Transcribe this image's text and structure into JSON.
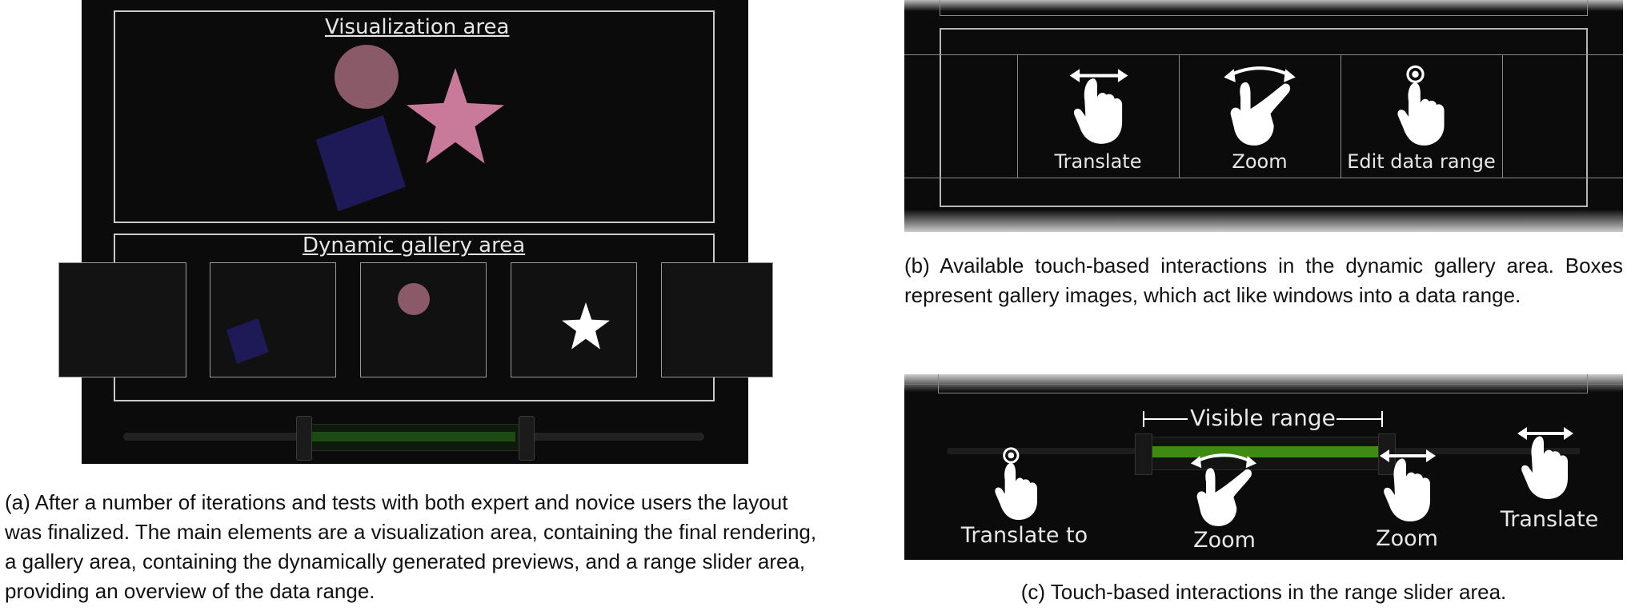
{
  "panel_a": {
    "visualization_label": "Visualization area",
    "gallery_label": "Dynamic gallery area",
    "caption": "(a) After a number of iterations and tests with both expert and novice users the layout was finalized. The main elements are a visualization area, containing the final rendering, a gallery area, containing the dynamically generated previews, and a range slider area, providing an overview of the data range.",
    "colors": {
      "circle": "#8b5a68",
      "star": "#c9799a",
      "square": "#1e1a58",
      "slider_fill": "#1c4a12"
    }
  },
  "panel_b": {
    "gestures": [
      {
        "label": "Translate",
        "icon": "translate-gesture-icon"
      },
      {
        "label": "Zoom",
        "icon": "zoom-gesture-icon"
      },
      {
        "label": "Edit data range",
        "icon": "tap-gesture-icon"
      }
    ],
    "caption": "(b) Available touch-based interactions in the dynamic gallery area. Boxes represent gallery images, which act like windows into a data range."
  },
  "panel_c": {
    "visible_range_label": "Visible range",
    "labels": {
      "translate_to": "Translate to",
      "zoom_left": "Zoom",
      "zoom_right": "Zoom",
      "translate": "Translate"
    },
    "caption": "(c) Touch-based interactions in the range slider area.",
    "colors": {
      "range_bar": "#3f8a12"
    }
  }
}
